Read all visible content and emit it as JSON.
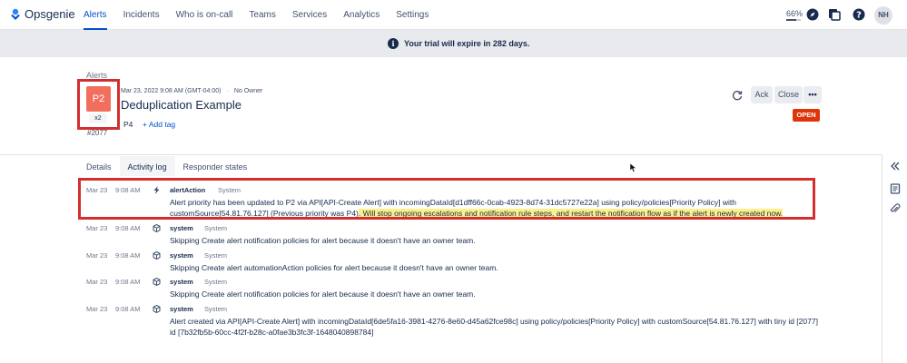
{
  "app": {
    "name": "Opsgenie"
  },
  "nav": {
    "items": [
      "Alerts",
      "Incidents",
      "Who is on-call",
      "Teams",
      "Services",
      "Analytics",
      "Settings"
    ],
    "active": "Alerts",
    "usage_percent": "66%",
    "usage_fraction": 0.66,
    "avatar_initials": "NH",
    "icons": [
      "compass-icon",
      "apps-icon",
      "help-icon"
    ]
  },
  "banner": {
    "text": "Your trial will expire in 282 days."
  },
  "alert": {
    "breadcrumb": "Alerts",
    "priority": "P2",
    "count": "x2",
    "tiny_id": "#2077",
    "date": "Mar 23, 2022 9:08 AM (GMT-04:00)",
    "owner": "No Owner",
    "title": "Deduplication Example",
    "priority_tag": "P4",
    "add_tag": "+ Add tag",
    "status": "OPEN",
    "actions": {
      "ack": "Ack",
      "close": "Close",
      "more": "•••"
    }
  },
  "tabs": [
    {
      "label": "Details"
    },
    {
      "label": "Activity log"
    },
    {
      "label": "Responder states"
    }
  ],
  "active_tab": "Activity log",
  "activity_log": [
    {
      "date": "Mar 23",
      "time": "9:08 AM",
      "actor": "alertAction",
      "source": "System",
      "icon": "bolt-icon",
      "message": "Alert priority has been updated to P2 via API[API-Create Alert] with incomingDataId[d1dff66c-0cab-4923-8d74-31dc5727e22a] using policy/policies[Priority Policy] with customSource[54.81.76.127] (Previous priority was P4)",
      "highlight": ". Will stop ongoing escalations and notification rule steps, and restart the notification flow as if the alert is newly created now."
    },
    {
      "date": "Mar 23",
      "time": "9:08 AM",
      "actor": "system",
      "source": "System",
      "icon": "cube-icon",
      "message": "Skipping Create alert notification policies for alert because it doesn't have an owner team."
    },
    {
      "date": "Mar 23",
      "time": "9:08 AM",
      "actor": "system",
      "source": "System",
      "icon": "cube-icon",
      "message": "Skipping Create alert automationAction policies for alert because it doesn't have an owner team."
    },
    {
      "date": "Mar 23",
      "time": "9:08 AM",
      "actor": "system",
      "source": "System",
      "icon": "cube-icon",
      "message": "Skipping Create alert notification policies for alert because it doesn't have an owner team."
    },
    {
      "date": "Mar 23",
      "time": "9:08 AM",
      "actor": "system",
      "source": "System",
      "icon": "cube-icon",
      "message": "Alert created via API[API-Create Alert] with incomingDataId[6de5fa16-3981-4276-8e60-d45a62fce98c] using policy/policies[Priority Policy] with customSource[54.81.76.127] with tiny id [2077] id [7b32fb5b-60cc-4f2f-b28c-a0fae3b3fc3f-1648040898784]"
    }
  ],
  "side_panel": {
    "icons": [
      "collapse-icon",
      "notes-icon",
      "attachment-icon"
    ]
  },
  "colors": {
    "accent": "#0052cc",
    "priority": "#f26f5f",
    "open": "#de350b",
    "highlight": "#fdf08a",
    "annotation": "#d32f2f"
  }
}
